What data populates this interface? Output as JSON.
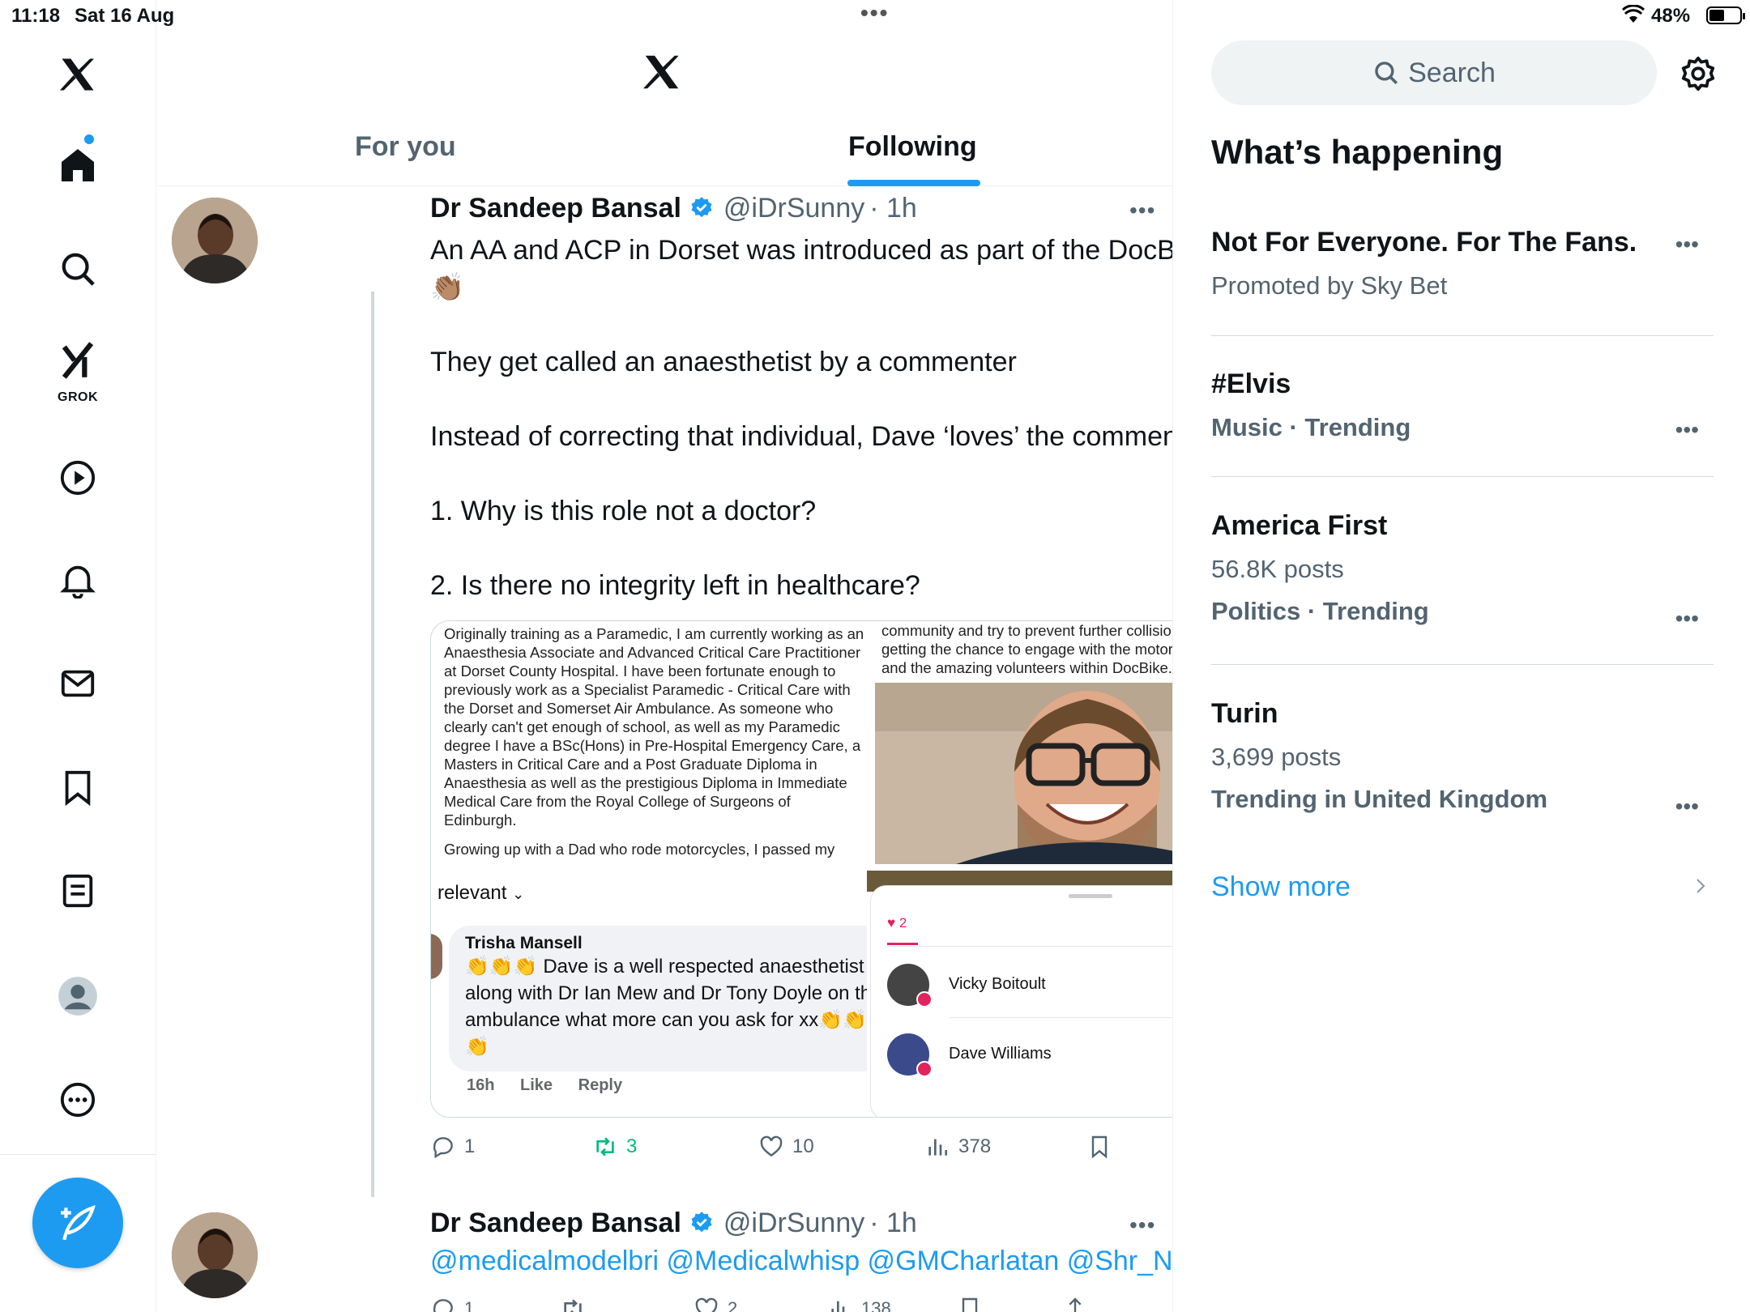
{
  "status_bar": {
    "time": "11:18",
    "date": "Sat 16 Aug",
    "battery": "48%"
  },
  "nav": {
    "items": [
      "home",
      "explore",
      "grok",
      "videos",
      "notifications",
      "messages",
      "bookmarks",
      "lists",
      "profile",
      "more"
    ],
    "grok_label": "GROK"
  },
  "feed": {
    "tabs": [
      {
        "label": "For you",
        "active": false
      },
      {
        "label": "Following",
        "active": true
      }
    ],
    "tweet1": {
      "name": "Dr Sandeep Bansal",
      "handle": "@iDrSunny",
      "time": "· 1h",
      "line1": "An AA and ACP in Dorset was introduced as part of the DocBike team 👏🏽",
      "line2": "They get called an anaesthetist by a commenter",
      "line3": "Instead of correcting that individual, Dave ‘loves’ the comment",
      "line4": "1. Why is this role not a doctor?",
      "line5": "2. Is there no integrity left in healthcare?",
      "media": {
        "bio": "Originally training as a Paramedic, I am currently working as an Anaesthesia Associate and Advanced Critical Care Practitioner at Dorset County Hospital. I have been fortunate enough to previously work as a Specialist Paramedic - Critical Care with the Dorset and Somerset Air Ambulance. As someone who clearly can't get enough of school, as well as my Paramedic degree I have a BSc(Hons) in Pre-Hospital Emergency Care, a Masters in Critical Care and a Post Graduate Diploma in Anaesthesia as well as the prestigious Diploma in Immediate Medical Care from the Royal College of Surgeons of Edinburgh.",
        "bio2": "Growing up with a Dad who rode motorcycles, I passed my",
        "relevant": "relevant",
        "comment_author": "Trisha Mansell",
        "comment_text": "👏👏👏 Dave is a well respected anaesthetist in DCH along with Dr Ian Mew and Dr Tony Doyle on the air ambulance what more can you ask for xx👏👏👏👏👏👏",
        "comment_time": "16h",
        "comment_like": "Like",
        "comment_reply": "Reply",
        "right_text": "community and try to prevent further collisions as well as getting the chance to engage with the motorcycle community and the amazing volunteers within DocBike.",
        "likes_count": "2",
        "likers": [
          "Vicky Boitoult",
          "Dave Williams"
        ]
      },
      "replies": "1",
      "reposts": "3",
      "likes": "10",
      "views": "378"
    },
    "tweet2": {
      "name": "Dr Sandeep Bansal",
      "handle": "@iDrSunny",
      "time": "· 1h",
      "text": "@medicalmodelbri @Medicalwhisp @GMCharlatan @Shr_Nottingham",
      "replies": "1",
      "likes": "2",
      "views": "138"
    }
  },
  "sidebar": {
    "search_placeholder": "Search",
    "title": "What’s happening",
    "trends": [
      {
        "line1": "Not For Everyone. For The Fans.",
        "line2": "Promoted by Sky Bet"
      },
      {
        "line1": "#Elvis",
        "line2": "Music · Trending"
      },
      {
        "line1": "America First",
        "line2": "56.8K posts",
        "line3": "Politics · Trending"
      },
      {
        "line1": "Turin",
        "line2": "3,699 posts",
        "line3": "Trending in United Kingdom"
      }
    ],
    "show_more": "Show more"
  },
  "colors": {
    "accent": "#1d9bf0",
    "repost_active": "#00ba7c",
    "like_red": "#e0245e",
    "muted": "#536471"
  },
  "icons": [
    "x-logo-icon",
    "home-icon",
    "search-icon",
    "grok-icon",
    "video-icon",
    "bell-icon",
    "mail-icon",
    "bookmark-icon",
    "list-icon",
    "profile-icon",
    "more-icon",
    "compose-icon",
    "verified-icon",
    "reply-icon",
    "repost-icon",
    "like-icon",
    "views-icon",
    "share-icon",
    "gear-icon",
    "chevron-right-icon"
  ]
}
